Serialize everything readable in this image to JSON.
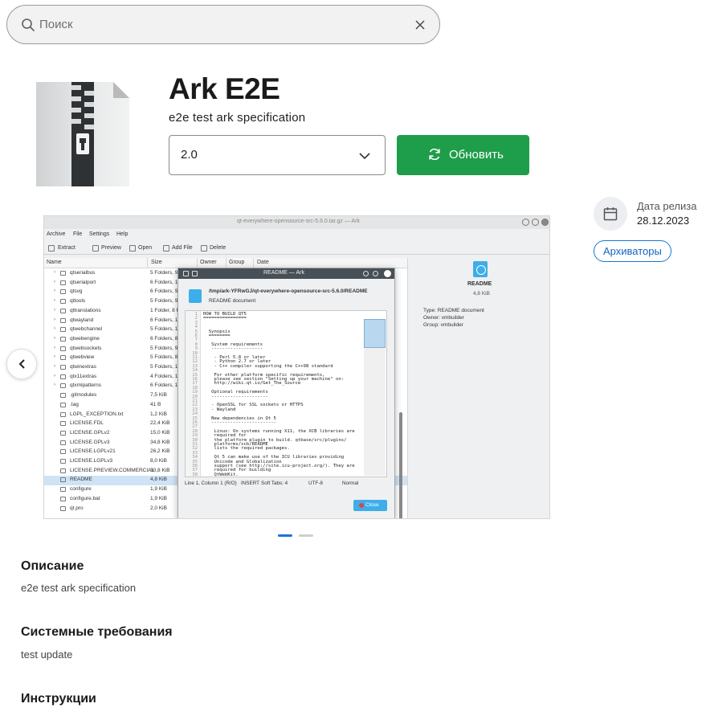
{
  "search": {
    "placeholder": "Поиск"
  },
  "app": {
    "title": "Ark E2E",
    "subtitle": "e2e test ark specification",
    "version": "2.0",
    "update_label": "Обновить"
  },
  "release": {
    "label": "Дата релиза",
    "date": "28.12.2023"
  },
  "category": "Архиваторы",
  "sections": {
    "description": {
      "title": "Описание",
      "text": "e2e test ark specification"
    },
    "requirements": {
      "title": "Системные требования",
      "text": "test update"
    },
    "instructions": {
      "title": "Инструкции"
    }
  },
  "carousel": {
    "slides": 2,
    "active": 1
  },
  "screenshot": {
    "window_title": "qt-everywhere-opensource-src-5.6.0.tar.gz — Ark",
    "menu": [
      "Archive",
      "File",
      "Settings",
      "Help"
    ],
    "toolbar": [
      "Extract",
      "Preview",
      "Open",
      "Add File",
      "Delete"
    ],
    "columns": [
      "Name",
      "Size",
      "Owner",
      "Group",
      "Date"
    ],
    "rows": [
      {
        "name": "qtserialbus",
        "size": "5 Folders, 9",
        "folder": true
      },
      {
        "name": "qtserialport",
        "size": "6 Folders, 10",
        "folder": true
      },
      {
        "name": "qtsvg",
        "size": "6 Folders, 9",
        "folder": true
      },
      {
        "name": "qttools",
        "size": "5 Folders, 9",
        "folder": true
      },
      {
        "name": "qttranslations",
        "size": "1 Folder, 8 F",
        "folder": true
      },
      {
        "name": "qtwayland",
        "size": "6 Folders, 10",
        "folder": true
      },
      {
        "name": "qtwebchannel",
        "size": "5 Folders, 11",
        "folder": true
      },
      {
        "name": "qtwebengine",
        "size": "6 Folders, 8",
        "folder": true
      },
      {
        "name": "qtwebsockets",
        "size": "5 Folders, 9",
        "folder": true
      },
      {
        "name": "qtwebview",
        "size": "5 Folders, 8",
        "folder": true
      },
      {
        "name": "qtwinextras",
        "size": "5 Folders, 11",
        "folder": true
      },
      {
        "name": "qtx11extras",
        "size": "4 Folders, 10",
        "folder": true
      },
      {
        "name": "qtxmlpatterns",
        "size": "6 Folders, 10",
        "folder": true
      },
      {
        "name": ".gitmodules",
        "size": "7,5 KiB",
        "folder": false
      },
      {
        "name": ".tag",
        "size": "41 B",
        "folder": false
      },
      {
        "name": "LGPL_EXCEPTION.txt",
        "size": "1,2 KiB",
        "folder": false
      },
      {
        "name": "LICENSE.FDL",
        "size": "22,4 KiB",
        "folder": false
      },
      {
        "name": "LICENSE.GPLv2",
        "size": "15,0 KiB",
        "folder": false
      },
      {
        "name": "LICENSE.GPLv3",
        "size": "34,8 KiB",
        "folder": false
      },
      {
        "name": "LICENSE.LGPLv21",
        "size": "26,2 KiB",
        "folder": false
      },
      {
        "name": "LICENSE.LGPLv3",
        "size": "8,0 KiB",
        "folder": false
      },
      {
        "name": "LICENSE.PREVIEW.COMMERCIAL",
        "size": "30,8 KiB",
        "folder": false
      },
      {
        "name": "README",
        "size": "4,8 KiB",
        "folder": false,
        "selected": true
      },
      {
        "name": "configure",
        "size": "1,9 KiB",
        "folder": false
      },
      {
        "name": "configure.bat",
        "size": "1,9 KiB",
        "folder": false
      },
      {
        "name": "qt.pro",
        "size": "2,0 KiB",
        "folder": false
      }
    ],
    "side": {
      "name": "README",
      "size": "4,8 KiB",
      "type": "Type: README document",
      "owner": "Owner: vmbuilder",
      "group": "Group: vmbuilder"
    },
    "dialog": {
      "title": "README — Ark",
      "path": "/tmp/ark-YFRwGJ/qt-everywhere-opensource-src-5.6.0/README",
      "kind": "README document",
      "lines": [
        "HOW TO BUILD QT5",
        "================",
        "",
        "",
        "  Synopsis",
        "  ========",
        "",
        "   System requirements",
        "   -------------------",
        "",
        "    - Perl 5.8 or later",
        "    - Python 2.7 or later",
        "    - C++ compiler supporting the C++98 standard",
        "",
        "    For other platform specific requirements,",
        "    please see section \"Setting up your machine\" on:",
        "    http://wiki.qt.io/Get_The_Source",
        "",
        "   Optional requirements",
        "   ---------------------",
        "",
        "   - OpenSSL for SSL sockets or HTTPS",
        "   - Wayland",
        "",
        "   New dependencies in Qt 5",
        "   ------------------------",
        "",
        "    Linux: On systems running X11, the XCB libraries are",
        "    required for",
        "    the platform plugin to build. qtbase/src/plugins/",
        "    platforms/xcb/README",
        "    lists the required packages.",
        "",
        "    Qt 5 can make use of the ICU libraries providing",
        "    Unicode and Globalization",
        "    support (see http://site.icu-project.org/). They are",
        "    required for building",
        "    QtWebKit."
      ],
      "status": {
        "position": "Line 1, Column 1 (R/O)",
        "mode": "INSERT",
        "tabs": "Soft Tabs: 4",
        "encoding": "UTF-8",
        "view": "Normal"
      },
      "close_label": "Close"
    }
  }
}
